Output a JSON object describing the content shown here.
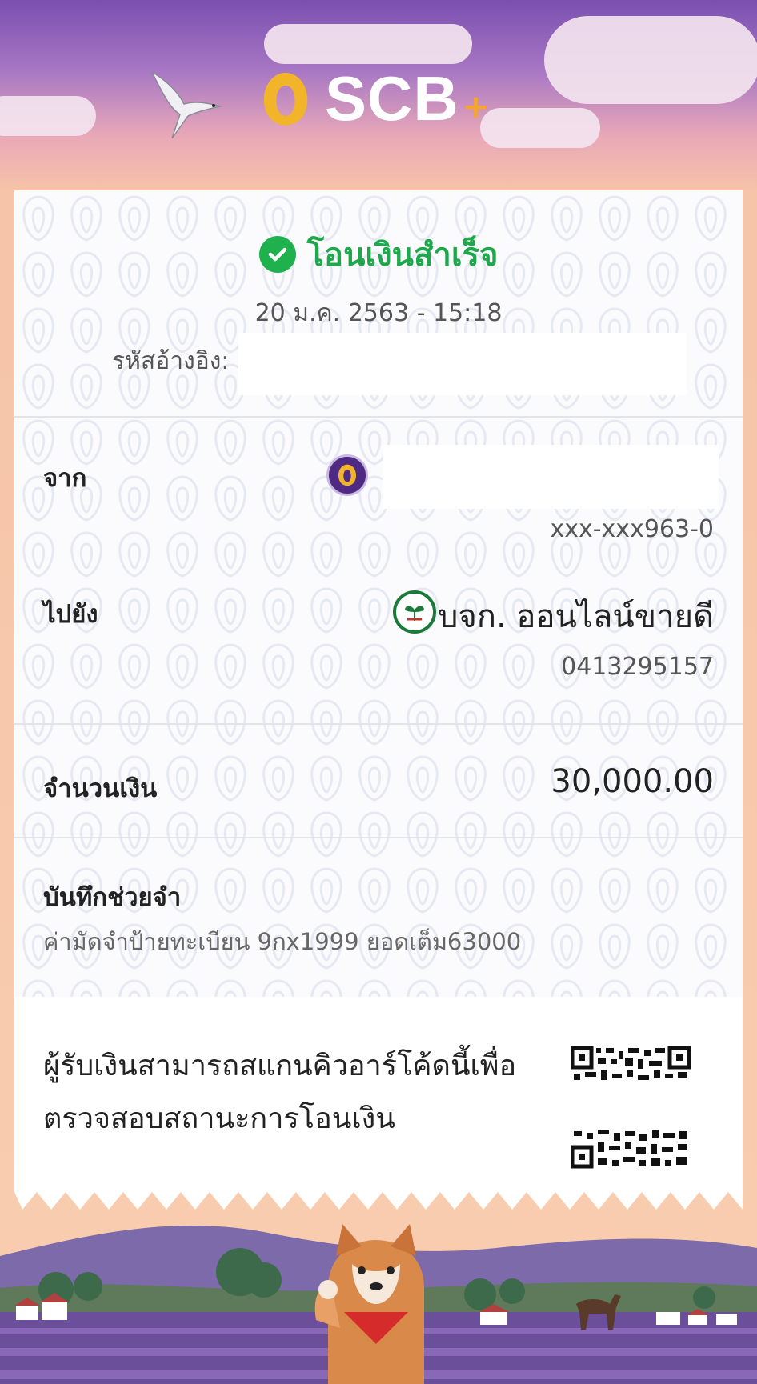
{
  "header": {
    "brand": "SCB",
    "brand_plus": "+"
  },
  "receipt": {
    "status": "โอนเงินสำเร็จ",
    "datetime": "20 ม.ค. 2563 - 15:18",
    "reference_label": "รหัสอ้างอิง:",
    "from": {
      "label": "จาก",
      "account": "xxx-xxx963-0"
    },
    "to": {
      "label": "ไปยัง",
      "name": "บจก. ออนไลน์ขายดี",
      "account": "0413295157"
    },
    "amount": {
      "label": "จำนวนเงิน",
      "value": "30,000.00"
    },
    "memo": {
      "label": "บันทึกช่วยจำ",
      "text": "ค่ามัดจำป้ายทะเบียน 9กx1999 ยอดเต็ม63000"
    },
    "qr_instruction_line1": "ผู้รับเงินสามารถสแกนคิวอาร์โค้ดนี้เพื่อ",
    "qr_instruction_line2": "ตรวจสอบสถานะการโอนเงิน"
  },
  "colors": {
    "success": "#1fa84b",
    "scb_purple": "#4f2a82",
    "kbank_green": "#1a7a3a",
    "logo_gold": "#f2b52a"
  },
  "icons": [
    "scb-logo-icon",
    "bird-illustration",
    "success-check-icon",
    "scb-bank-icon",
    "kbank-bank-icon",
    "qr-code-icon",
    "shiba-dog-illustration"
  ]
}
